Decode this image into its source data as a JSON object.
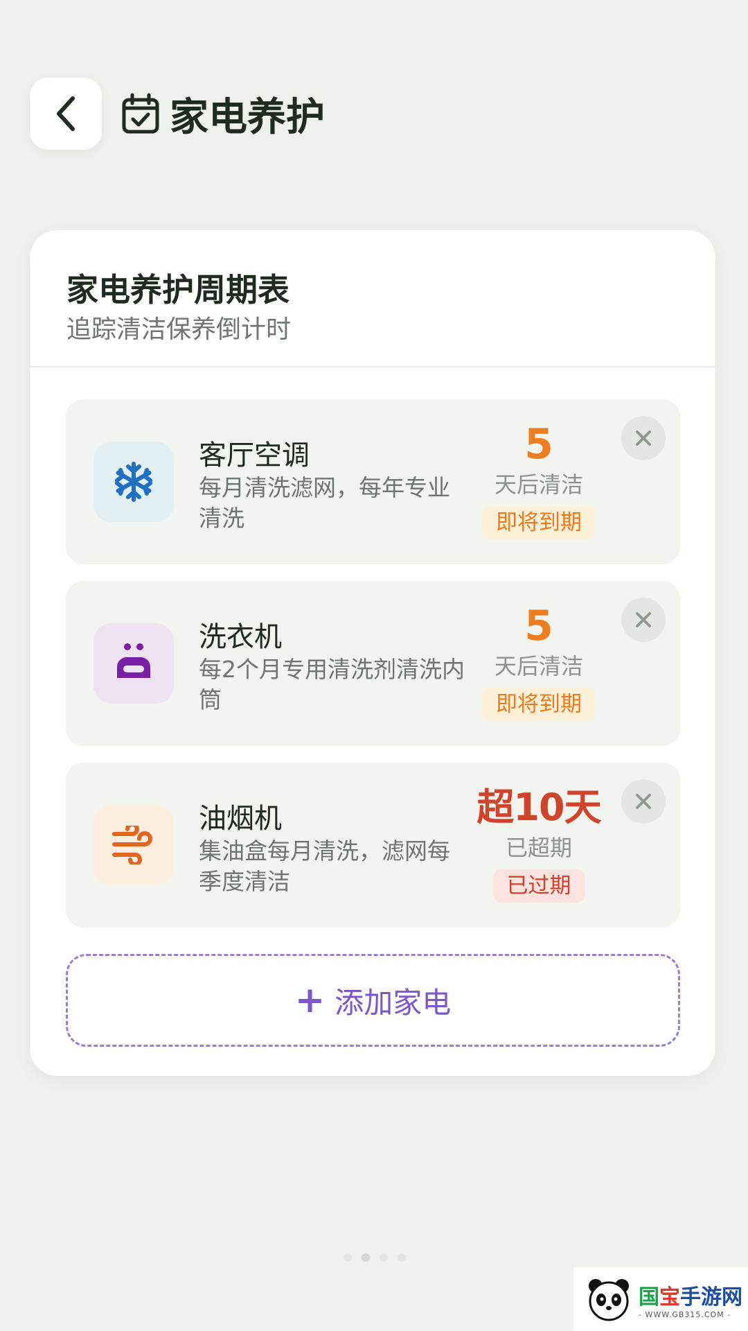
{
  "header": {
    "title": "家电养护",
    "back_icon": "chevron-left-icon",
    "title_icon": "calendar-check-icon"
  },
  "card": {
    "title": "家电养护周期表",
    "subtitle": "追踪清洁保养倒计时"
  },
  "items": [
    {
      "name": "客厅空调",
      "desc": "每月清洗滤网，每年专业清洗",
      "count": "5",
      "count_label": "天后清洁",
      "badge": "即将到期",
      "icon": "snowflake-icon",
      "icon_bg": "#e3f0f3",
      "icon_color": "#1f6fc2",
      "status": "soon"
    },
    {
      "name": "洗衣机",
      "desc": "每2个月专用清洗剂清洗内筒",
      "count": "5",
      "count_label": "天后清洁",
      "badge": "即将到期",
      "icon": "washing-machine-icon",
      "icon_bg": "#efe3f3",
      "icon_color": "#7b1fa6",
      "status": "soon"
    },
    {
      "name": "油烟机",
      "desc": "集油盒每月清洗，滤网每季度清洁",
      "count": "超10天",
      "count_label": "已超期",
      "badge": "已过期",
      "icon": "wind-icon",
      "icon_bg": "#fdeee0",
      "icon_color": "#e1671f",
      "status": "overdue"
    }
  ],
  "add_button": {
    "label": "添加家电"
  },
  "colors": {
    "accent": "#7f56c9",
    "soon": "#ee7d20",
    "overdue": "#d1442b",
    "background": "#eef1ec"
  },
  "watermark": {
    "logo_text": "国宝手游网",
    "url": "- WWW.GB315.COM -"
  }
}
